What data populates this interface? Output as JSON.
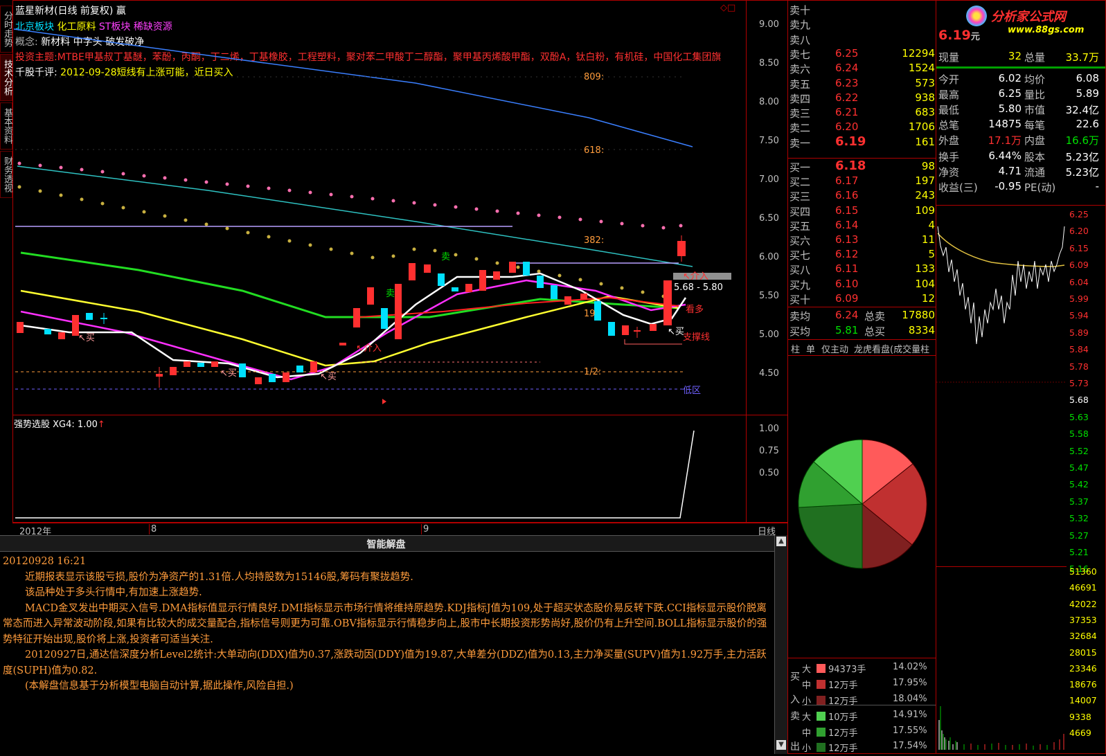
{
  "chart_header": {
    "title": "蓝星新材(日线 前复权) 赢",
    "sectors": [
      "北京板块",
      "化工原料",
      "ST板块",
      "稀缺资源"
    ],
    "concept_label": "概念:",
    "concepts": "新材料 中字头 破发破净",
    "theme_label": "投资主题:",
    "theme": "MTBE甲基叔丁基醚，苯酚，丙酮，丁二烯，丁基橡胶，工程塑料，聚对苯二甲酸丁二醇酯，聚甲基丙烯酸甲酯，双酚A，钛白粉，有机硅，中国化工集团旗",
    "comment_label": "千股千评:",
    "comment": "2012-09-28短线有上涨可能，近日买入"
  },
  "left_tabs": [
    "分时走势",
    "技术分析",
    "基本资料",
    "财务透视"
  ],
  "price_axis": [
    "9.00",
    "8.50",
    "8.00",
    "7.50",
    "7.00",
    "6.50",
    "6.00",
    "5.50",
    "5.00",
    "4.50"
  ],
  "chart_annotations": {
    "fib_809": "809:",
    "fib_618": "618:",
    "fib_382": "382:",
    "fib_19": "19",
    "fib_half": "1/2:",
    "sell_1": "卖",
    "sell_2": "卖",
    "buy_1": "买",
    "buy_2": "买",
    "buy_3": "买",
    "buy_4": "买",
    "intervene_1": "介入",
    "intervene_2": "介入",
    "range": "5.68 - 5.80",
    "bullish": "看多",
    "support": "支撑线",
    "low_zone": "低区"
  },
  "indicator": {
    "label": "强势选股",
    "value_label": "XG4: 1.00",
    "axis": [
      "1.00",
      "0.75",
      "0.50"
    ]
  },
  "date_axis": {
    "year": "2012年",
    "m8": "8",
    "m9": "9",
    "period": "日线"
  },
  "analysis": {
    "title": "智能解盘",
    "timestamp": "20120928  16:21",
    "paragraphs": [
      "近期报表显示该股亏损,股价为净资产的1.31倍.人均持股数为15146股,筹码有聚拢趋势.",
      "该品种处于多头行情中,有加速上涨趋势.",
      "MACD金叉发出中期买入信号.DMA指标值显示行情良好.DMI指标显示市场行情将维持原趋势.KDJ指标J值为109,处于超买状态股价易反转下跌.CCI指标显示股价脱离常态而进入异常波动阶段,如果有比较大的成交量配合,指标信号则更为可靠.OBV指标显示行情稳步向上,股市中长期投资形势尚好,股价仍有上升空间.BOLL指标显示股价的强势特征开始出现,股价将上涨,投资者可适当关注.",
      "20120927日,通达信深度分析Level2统计:大单动向(DDX)值为0.37,涨跌动因(DDY)值为19.87,大单差分(DDZ)值为0.13,主力净买量(SUPV)值为1.92万手,主力活跃度(SUPH)值为0.82.",
      "(本解盘信息基于分析模型电脑自动计算,据此操作,风险自担.)"
    ]
  },
  "order_book": {
    "asks": [
      {
        "label": "卖十",
        "price": "",
        "vol": ""
      },
      {
        "label": "卖九",
        "price": "",
        "vol": ""
      },
      {
        "label": "卖八",
        "price": "",
        "vol": ""
      },
      {
        "label": "卖七",
        "price": "6.25",
        "vol": "12294"
      },
      {
        "label": "卖六",
        "price": "6.24",
        "vol": "1524"
      },
      {
        "label": "卖五",
        "price": "6.23",
        "vol": "573"
      },
      {
        "label": "卖四",
        "price": "6.22",
        "vol": "938"
      },
      {
        "label": "卖三",
        "price": "6.21",
        "vol": "683"
      },
      {
        "label": "卖二",
        "price": "6.20",
        "vol": "1706"
      },
      {
        "label": "卖一",
        "price": "6.19",
        "vol": "161"
      }
    ],
    "bids": [
      {
        "label": "买一",
        "price": "6.18",
        "vol": "98"
      },
      {
        "label": "买二",
        "price": "6.17",
        "vol": "197"
      },
      {
        "label": "买三",
        "price": "6.16",
        "vol": "243"
      },
      {
        "label": "买四",
        "price": "6.15",
        "vol": "109"
      },
      {
        "label": "买五",
        "price": "6.14",
        "vol": "4"
      },
      {
        "label": "买六",
        "price": "6.13",
        "vol": "11"
      },
      {
        "label": "买七",
        "price": "6.12",
        "vol": "5"
      },
      {
        "label": "买八",
        "price": "6.11",
        "vol": "133"
      },
      {
        "label": "买九",
        "price": "6.10",
        "vol": "104"
      },
      {
        "label": "买十",
        "price": "6.09",
        "vol": "12"
      }
    ],
    "avg_ask_label": "卖均",
    "avg_ask": "6.24",
    "total_ask_label": "总卖",
    "total_ask": "17880",
    "avg_bid_label": "买均",
    "avg_bid": "5.81",
    "total_bid_label": "总买",
    "total_bid": "8334",
    "tabs": [
      "柱",
      "单",
      "仅主动",
      "龙虎看盘(成交量柱"
    ]
  },
  "brand": {
    "name": "分析家公式网",
    "url": "www.88gs.com"
  },
  "quote": {
    "price": "6.19",
    "price_unit": "元",
    "rows": [
      {
        "l1": "现量",
        "v1": "32",
        "l2": "总量",
        "v2": "33.7万"
      },
      {
        "l1": "今开",
        "v1": "6.02",
        "l2": "均价",
        "v2": "6.08"
      },
      {
        "l1": "最高",
        "v1": "6.25",
        "l2": "量比",
        "v2": "5.89"
      },
      {
        "l1": "最低",
        "v1": "5.80",
        "l2": "市值",
        "v2": "32.4亿"
      },
      {
        "l1": "总笔",
        "v1": "14875",
        "l2": "每笔",
        "v2": "22.6"
      },
      {
        "l1": "外盘",
        "v1": "17.1万",
        "l2": "内盘",
        "v2": "16.6万"
      },
      {
        "l1": "换手",
        "v1": "6.44%",
        "l2": "股本",
        "v2": "5.23亿"
      },
      {
        "l1": "净资",
        "v1": "4.71",
        "l2": "流通",
        "v2": "5.23亿"
      },
      {
        "l1": "收益(三)",
        "v1": "-0.95",
        "l2": "PE(动)",
        "v2": "-"
      }
    ]
  },
  "intraday_axis": [
    "6.25",
    "6.20",
    "6.15",
    "6.09",
    "6.04",
    "5.99",
    "5.94",
    "5.89",
    "5.84",
    "5.78",
    "5.73",
    "5.68",
    "5.63",
    "5.58",
    "5.52",
    "5.47",
    "5.42",
    "5.37",
    "5.32",
    "5.27",
    "5.21",
    "5.16"
  ],
  "volume_axis": [
    "51360",
    "46691",
    "42022",
    "37353",
    "32684",
    "28015",
    "23346",
    "18676",
    "14007",
    "9338",
    "4669"
  ],
  "money_flow": {
    "buy_side": [
      "买",
      "入"
    ],
    "sell_side": [
      "卖",
      "出"
    ],
    "rows": [
      {
        "size": "大",
        "amount": "94373手",
        "pct": "14.02%",
        "color": "#ff5a5a"
      },
      {
        "size": "中",
        "amount": "12万手",
        "pct": "17.95%",
        "color": "#c03030"
      },
      {
        "size": "小",
        "amount": "12万手",
        "pct": "18.04%",
        "color": "#802020"
      },
      {
        "size": "大",
        "amount": "10万手",
        "pct": "14.91%",
        "color": "#50d050"
      },
      {
        "size": "中",
        "amount": "12万手",
        "pct": "17.55%",
        "color": "#30a030"
      },
      {
        "size": "小",
        "amount": "12万手",
        "pct": "17.54%",
        "color": "#207020"
      }
    ]
  },
  "colors": {
    "up": "#ff3030",
    "down": "#00e0ff",
    "frame": "#b00000"
  }
}
